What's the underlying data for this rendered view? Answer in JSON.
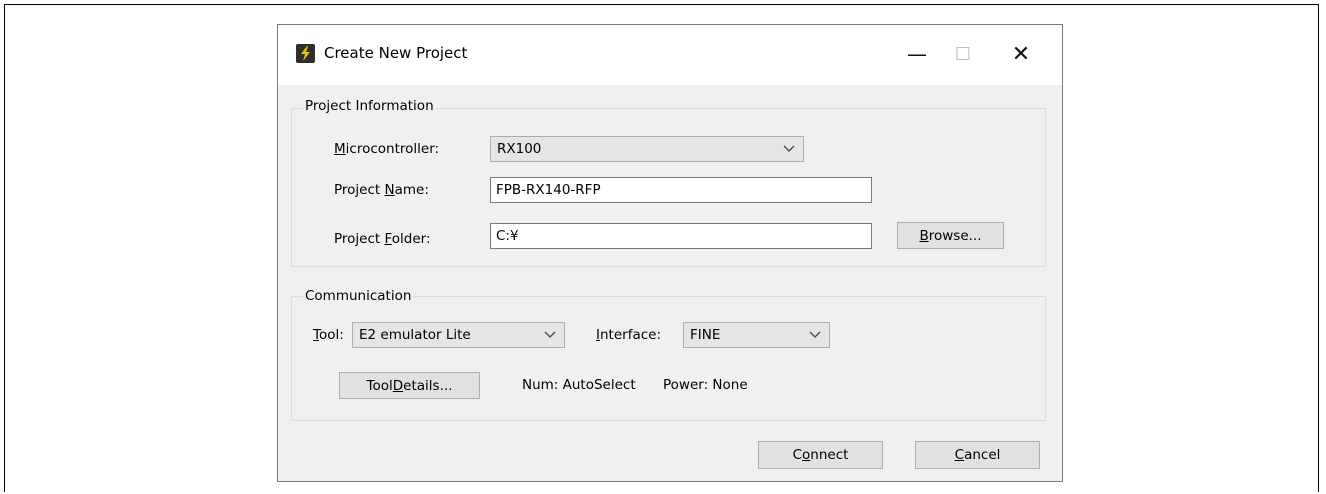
{
  "dialog": {
    "title": "Create New Project"
  },
  "window_controls": {
    "minimize": "—",
    "maximize": "☐",
    "close": "✕"
  },
  "project_info": {
    "group_label": "Project Information",
    "microcontroller": {
      "mnemonic": "M",
      "rest": "icrocontroller:",
      "value": "RX100"
    },
    "project_name": {
      "pre": "Project ",
      "mnemonic": "N",
      "post": "ame:",
      "value": "FPB-RX140-RFP"
    },
    "project_folder": {
      "pre": "Project ",
      "mnemonic": "F",
      "post": "older:",
      "value": "C:¥"
    },
    "browse_button": {
      "mnemonic": "B",
      "rest": "rowse..."
    }
  },
  "communication": {
    "group_label": "Communication",
    "tool": {
      "mnemonic": "T",
      "rest": "ool:",
      "value": "E2 emulator Lite"
    },
    "interface": {
      "mnemonic": "I",
      "rest": "nterface:",
      "value": "FINE"
    },
    "tool_details_button": {
      "pre": "Tool ",
      "mnemonic": "D",
      "post": "etails..."
    },
    "status_num": "Num: AutoSelect",
    "status_power": "Power: None"
  },
  "footer": {
    "connect_button": {
      "pre": "C",
      "mnemonic": "o",
      "post": "nnect"
    },
    "cancel_button": {
      "mnemonic": "C",
      "rest": "ancel"
    }
  }
}
